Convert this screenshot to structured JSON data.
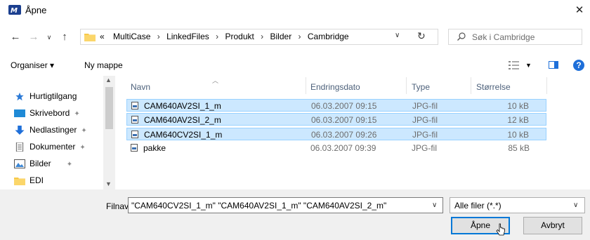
{
  "window": {
    "title": "Åpne"
  },
  "address": {
    "crumbs": [
      "«",
      "MultiCase",
      "LinkedFiles",
      "Produkt",
      "Bilder",
      "Cambridge"
    ]
  },
  "search": {
    "placeholder": "Søk i Cambridge"
  },
  "toolbar": {
    "organise": "Organiser ▾",
    "new_folder": "Ny mappe"
  },
  "sidebar": {
    "items": [
      {
        "label": "Hurtigtilgang",
        "icon": "star-icon"
      },
      {
        "label": "Skrivebord",
        "icon": "desktop-icon",
        "pinned": true
      },
      {
        "label": "Nedlastinger",
        "icon": "download-icon",
        "pinned": true
      },
      {
        "label": "Dokumenter",
        "icon": "documents-icon",
        "pinned": true
      },
      {
        "label": "Bilder",
        "icon": "pictures-icon",
        "pinned": true
      },
      {
        "label": "EDI",
        "icon": "folder-icon"
      }
    ]
  },
  "columns": [
    "Navn",
    "Endringsdato",
    "Type",
    "Størrelse"
  ],
  "files": [
    {
      "name": "CAM640AV2SI_1_m",
      "date": "06.03.2007 09:15",
      "type": "JPG-fil",
      "size": "10 kB",
      "selected": true
    },
    {
      "name": "CAM640AV2SI_2_m",
      "date": "06.03.2007 09:15",
      "type": "JPG-fil",
      "size": "12 kB",
      "selected": true
    },
    {
      "name": "CAM640CV2SI_1_m",
      "date": "06.03.2007 09:26",
      "type": "JPG-fil",
      "size": "10 kB",
      "selected": true
    },
    {
      "name": "pakke",
      "date": "06.03.2007 09:39",
      "type": "JPG-fil",
      "size": "85 kB",
      "selected": false
    }
  ],
  "bottom": {
    "filename_label": "Filnavn:",
    "filename_value": "\"CAM640CV2SI_1_m\" \"CAM640AV2SI_1_m\" \"CAM640AV2SI_2_m\"",
    "filter": "Alle filer (*.*)",
    "open_label": "Åpne",
    "cancel_label": "Avbryt"
  },
  "colors": {
    "selection": "#cce8ff",
    "accent": "#0078d7",
    "folder": "#f7c948"
  }
}
